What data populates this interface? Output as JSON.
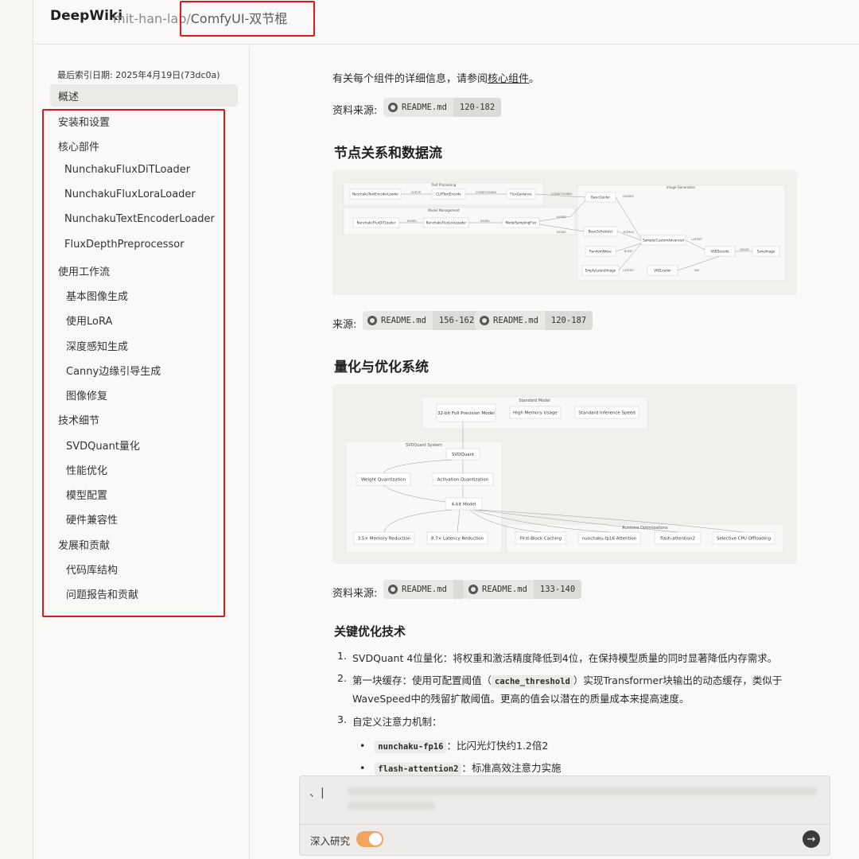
{
  "header": {
    "brand": "DeepWiki",
    "repo_owner": "mit-han-lab/",
    "repo_name": "ComfyUI-双节棍"
  },
  "sidebar": {
    "date": "最后索引日期:  2025年4月19日(73dc0a)",
    "items": [
      {
        "label": "概述"
      },
      {
        "label": "安装和设置"
      },
      {
        "label": "核心部件"
      },
      {
        "label": "NunchakuFluxDiTLoader"
      },
      {
        "label": "NunchakuFluxLoraLoader"
      },
      {
        "label": "NunchakuTextEncoderLoader"
      },
      {
        "label": "FluxDepthPreprocessor"
      },
      {
        "label": "使用工作流"
      },
      {
        "label": "基本图像生成"
      },
      {
        "label": "使用LoRA"
      },
      {
        "label": "深度感知生成"
      },
      {
        "label": "Canny边缘引导生成"
      },
      {
        "label": "图像修复"
      },
      {
        "label": "技术细节"
      },
      {
        "label": "SVDQuant量化"
      },
      {
        "label": "性能优化"
      },
      {
        "label": "模型配置"
      },
      {
        "label": "硬件兼容性"
      },
      {
        "label": "发展和贡献"
      },
      {
        "label": "代码库结构"
      },
      {
        "label": "问题报告和贡献"
      }
    ]
  },
  "main": {
    "intro_prefix": "有关每个组件的详细信息，请参阅",
    "intro_link": "核心组件",
    "intro_suffix": "。",
    "source1_label": "资料来源:",
    "source1": {
      "file": "README.md",
      "range": "120-182"
    },
    "h2_dataflow": "节点关系和数据流",
    "diagram1": {
      "groups": {
        "text": "Text Processing",
        "model": "Model Management",
        "image": "Image Generation"
      },
      "nodes": {
        "te": "NunchakuTextEncoderLoader",
        "clip": "CLIPTextEncode",
        "flux_guid": "FluxGuidance",
        "dit": "NunchakuFluxDiTLoader",
        "lora": "NunchakuFluxLoraLoader",
        "msf": "ModelSamplingFlux",
        "guider": "BasicGuider",
        "sched": "BasicScheduler",
        "noise": "RandomNoise",
        "sca": "SamplerCustomAdvanced",
        "empty": "EmptyLatentImage",
        "vaeloader": "VAELoader",
        "vaedecode": "VAEDecode",
        "save": "SaveImage"
      },
      "edges": {
        "clip": "CLIP/TE",
        "cond": "CONDITIONING",
        "cond2": "CONDITIONING",
        "model": "MODEL",
        "model2": "MODEL",
        "model3": "MODEL",
        "model4": "MODEL",
        "guider": "GUIDER",
        "sigmas": "SIGMAS",
        "noise": "NOISE",
        "latent": "LATENT",
        "latent2": "LATENT",
        "vae": "VAE",
        "image": "IMAGE"
      }
    },
    "source2_label": "来源:",
    "source2a": {
      "file": "README.md",
      "range": "156-162"
    },
    "source2b": {
      "file": "README.md",
      "range": "120-187"
    },
    "h2_quant": "量化与优化系统",
    "diagram2": {
      "groups": {
        "standard": "Standard Model",
        "svd": "SVDQuant System",
        "runtime": "Runtime Optimizations"
      },
      "nodes": {
        "fp32": "32-bit Full Precision Model",
        "mem": "High Memory Usage",
        "speed": "Standard Inference Speed",
        "svdq": "SVDQuant",
        "wq": "Weight Quantization",
        "aq": "Activation Quantization",
        "m4": "4-bit Model",
        "memred": "3.5× Memory Reduction",
        "latred": "8.7× Latency Reduction",
        "fbc": "First-Block Caching",
        "nfp16": "nunchaku-fp16 Attention",
        "fa2": "flash-attention2",
        "cpu": "Selective CPU Offloading"
      }
    },
    "source3_label": "资料来源:",
    "source3a": {
      "file": "README.md",
      "range": ""
    },
    "source3b": {
      "file": "README.md",
      "range": "133-140"
    },
    "h3_key": "关键优化技术",
    "list": {
      "n1": "1.",
      "t1": "SVDQuant 4位量化：将权重和激活精度降低到4位，在保持模型质量的同时显著降低内存需求。",
      "n2": "2.",
      "t2a": "第一块缓存：使用可配置阈值（",
      "t2code": "cache_threshold",
      "t2b": "）实现Transformer块输出的动态缓存，类似于",
      "t2c": "WaveSpeed中的残留扩散阈值。更高的值会以潜在的质量成本来提高速度。",
      "n3": "3.",
      "t3": "自定义注意力机制：",
      "b1code": "nunchaku-fp16",
      "b1": "：比闪光灯快约1.2倍2",
      "b2code": "flash-attention2",
      "b2": "：标准高效注意力实施"
    }
  },
  "chat": {
    "input_value": "、|",
    "toggle_label": "深入研究",
    "send_icon": "arrow-right-icon"
  }
}
